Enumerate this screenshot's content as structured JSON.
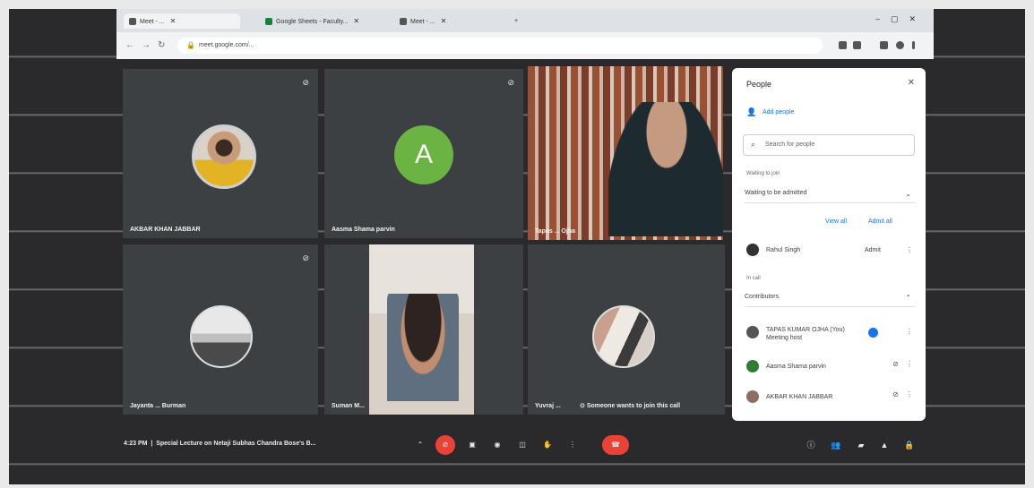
{
  "browser": {
    "tabs": [
      {
        "label": "Meet - ..."
      },
      {
        "label": "Google Sheets - Faculty..."
      },
      {
        "label": "Meet - ..."
      }
    ],
    "url": "meet.google.com/..."
  },
  "tiles": [
    {
      "name": "AKBAR KHAN JABBAR",
      "avatar": "photo"
    },
    {
      "name": "Aasma Shama parvin",
      "avatar": "A"
    },
    {
      "name": "Tapas ... Ojha",
      "avatar": "video"
    },
    {
      "name": "Jayanta ... Burman",
      "avatar": "photo"
    },
    {
      "name": "Suman M...",
      "avatar": "video"
    },
    {
      "name": "Yuvraj ...",
      "avatar": "photo"
    }
  ],
  "joining_notice": "Someone wants to join this call",
  "people_panel": {
    "title": "People",
    "add_people": "Add people",
    "search_placeholder": "Search for people",
    "section_waiting": "Waiting to join",
    "select_value": "Waiting to be admitted",
    "view_all": "View all",
    "admit_all": "Admit all",
    "waiting_person": {
      "name": "Rahul Singh",
      "action": "Admit"
    },
    "section_in_call": "In call",
    "contributors_label": "Contributors",
    "participants": [
      {
        "name": "TAPAS KUMAR OJHA (You) Meeting host"
      },
      {
        "name": "Aasma Shama parvin"
      },
      {
        "name": "AKBAR KHAN JABBAR"
      }
    ]
  },
  "bottom_bar": {
    "time": "4:23 PM",
    "meeting_title": "Special Lecture on Netaji Subhas Chandra Bose's B..."
  }
}
